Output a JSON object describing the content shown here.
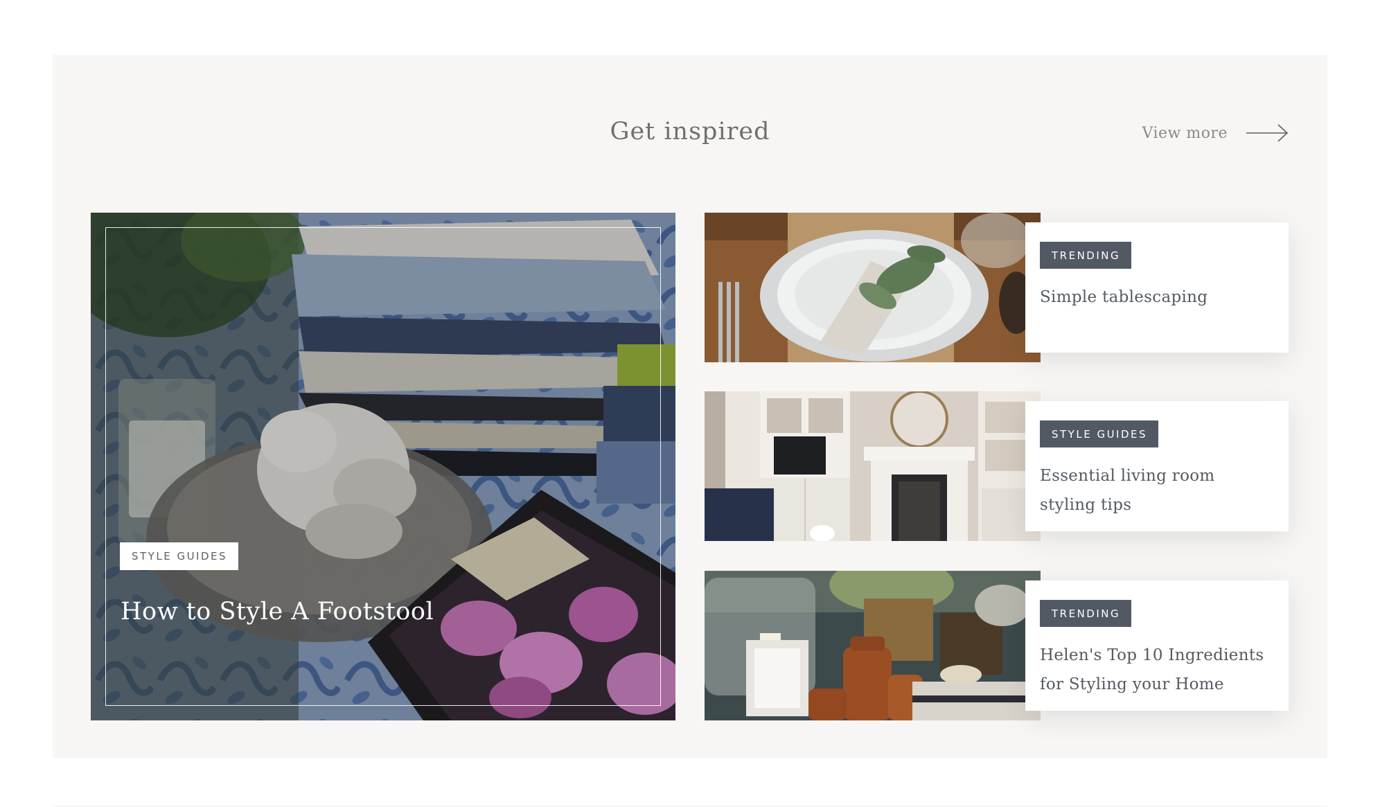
{
  "section": {
    "title": "Get inspired",
    "view_more_label": "View more"
  },
  "featured": {
    "tag": "STYLE GUIDES",
    "title": "How to Style A Footstool"
  },
  "articles": [
    {
      "tag": "TRENDING",
      "title": "Simple tablescaping"
    },
    {
      "tag": "STYLE GUIDES",
      "title": "Essential living room styling tips"
    },
    {
      "tag": "TRENDING",
      "title": "Helen's Top 10 Ingredients for Styling your Home"
    }
  ],
  "icons": {
    "view_more": "arrow-right-icon"
  },
  "colors": {
    "panel_bg": "#f7f6f4",
    "tag_dark": "#525963",
    "text_muted": "#6f6f6f"
  }
}
